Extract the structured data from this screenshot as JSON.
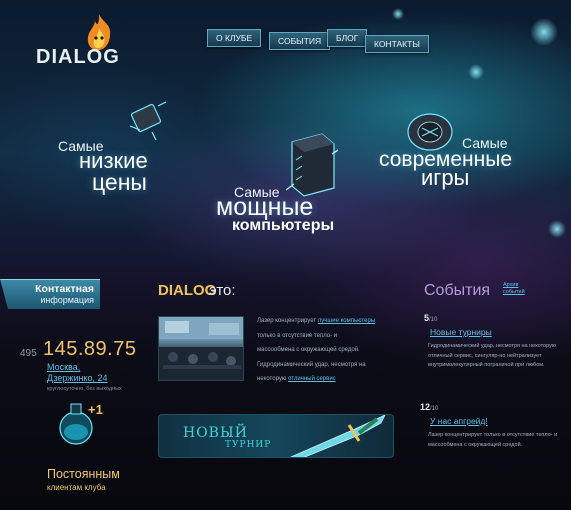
{
  "brand": {
    "logo_text": "DIALOG"
  },
  "nav": {
    "items": [
      "О КЛУБЕ",
      "СОБЫТИЯ",
      "БЛОГ",
      "КОНТАКТЫ"
    ]
  },
  "hero": {
    "left": {
      "line1": "Самые",
      "line2": "низкие",
      "line3": "цены"
    },
    "center": {
      "line1": "Самые",
      "line2": "мощные",
      "line3": "компьютеры"
    },
    "right": {
      "line1": "Самые",
      "line2": "современные",
      "line3": "игры"
    }
  },
  "contact": {
    "title": "Контактная",
    "subtitle": "информация",
    "phone_code": "495",
    "phone": "145.89.75",
    "address_line1": "Москва,",
    "address_line2": "Дзержинко, 24",
    "hours": "круглосуточно, без выходных",
    "promo_line1": "Постоянным",
    "promo_line2": "клиентам клуба"
  },
  "about": {
    "brand": "DIALOG",
    "heading_rest": "это:",
    "line1_pre": "Лазер концентрирует",
    "line1_link": "лучшие компьютеры",
    "line2": "только в отсутствие тепло- и",
    "line3": "массообмена с окружающей средой.",
    "line4": "Гидродинамический удар, несмотря на",
    "line5_pre": "некоторую",
    "line5_link": "отличный сервис",
    "banner_line1": "НОВЫЙ",
    "banner_line2": "ТУРНИР"
  },
  "events": {
    "title": "События",
    "all_line1": "Архив",
    "all_line2": "событий",
    "items": [
      {
        "num": "5",
        "total": "/10",
        "title": "Новые турниры",
        "body": "Гидродинамический удар, несмотря на некоторую отличный сервис, сингуляр-но нейтрализует внутримолекулярный пограничой при любом."
      },
      {
        "num": "12",
        "total": "/10",
        "title": "У нас апгрейд!",
        "body": "Лазер концентрирует только в отсутствие тепло- и массообмена с окружающей средой."
      }
    ]
  },
  "colors": {
    "accent_gold": "#f1c15b",
    "link_blue": "#5fc0e6",
    "events_purple": "#b79ae0",
    "nav_bg": "#2e6278"
  }
}
